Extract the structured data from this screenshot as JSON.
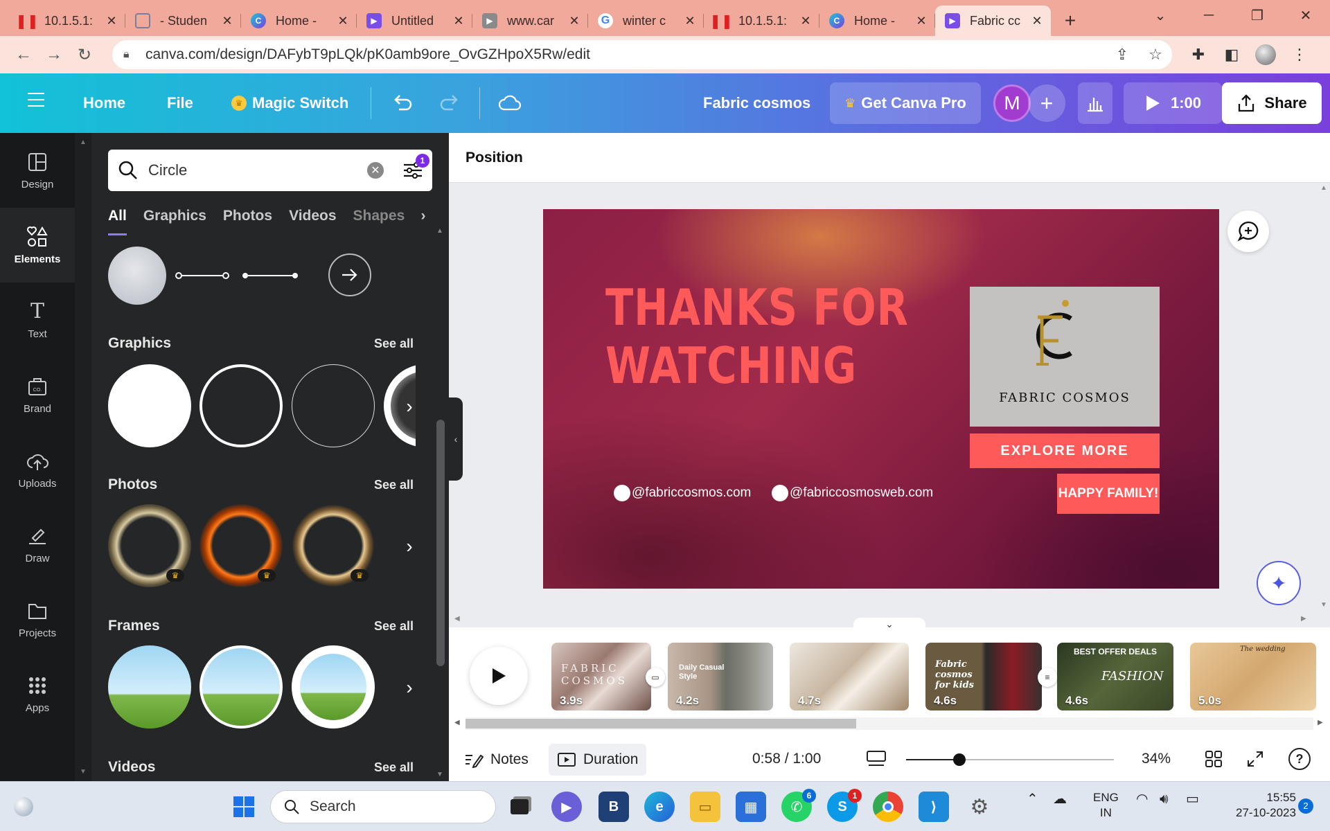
{
  "browser": {
    "tabs": [
      {
        "label": "10.1.5.1:",
        "icon": "pause-red-icon",
        "color": "#e02020"
      },
      {
        "label": "- Studen",
        "icon": "document-icon",
        "color": "#7a7f99"
      },
      {
        "label": "Home -",
        "icon": "canva-icon",
        "color": "#3a7be0"
      },
      {
        "label": "Untitled",
        "icon": "video-icon",
        "color": "#7a4de8"
      },
      {
        "label": "www.car",
        "icon": "play-icon",
        "color": "#8a8a8a"
      },
      {
        "label": "winter c",
        "icon": "google-icon",
        "color": "#ffffff"
      },
      {
        "label": "10.1.5.1:",
        "icon": "pause-red-icon",
        "color": "#e02020"
      },
      {
        "label": "Home -",
        "icon": "canva-icon",
        "color": "#3a7be0"
      },
      {
        "label": "Fabric cc",
        "icon": "video-icon",
        "color": "#7a4de8"
      }
    ],
    "url": "canva.com/design/DAFybT9pLQk/pK0amb9ore_OvGZHpoX5Rw/edit"
  },
  "canva": {
    "home": "Home",
    "file": "File",
    "magic_switch": "Magic Switch",
    "title": "Fabric cosmos",
    "get_pro": "Get Canva Pro",
    "avatar_initial": "M",
    "duration": "1:00",
    "share": "Share"
  },
  "rail": [
    {
      "label": "Design",
      "icon": "design-icon"
    },
    {
      "label": "Elements",
      "icon": "elements-icon"
    },
    {
      "label": "Text",
      "icon": "text-icon"
    },
    {
      "label": "Brand",
      "icon": "brand-icon"
    },
    {
      "label": "Uploads",
      "icon": "upload-icon"
    },
    {
      "label": "Draw",
      "icon": "draw-icon"
    },
    {
      "label": "Projects",
      "icon": "folder-icon"
    },
    {
      "label": "Apps",
      "icon": "apps-icon"
    }
  ],
  "panel": {
    "search_value": "Circle",
    "filter_badge": "1",
    "tabs": [
      "All",
      "Graphics",
      "Photos",
      "Videos",
      "Shapes"
    ],
    "sections": {
      "graphics": "Graphics",
      "photos": "Photos",
      "frames": "Frames",
      "videos": "Videos"
    },
    "see_all": "See all"
  },
  "editor": {
    "context": "Position",
    "slide": {
      "headline_1": "THANKS FOR",
      "headline_2": "WATCHING",
      "logo_text": "FABRIC COSMOS",
      "explore": "EXPLORE MORE",
      "happy": "HAPPY FAMILY!",
      "social_1": "@fabriccosmos.com",
      "social_2": "@fabriccosmosweb.com"
    }
  },
  "timeline": {
    "pages": [
      {
        "duration": "3.9s",
        "caption": "FABRIC COSMOS"
      },
      {
        "duration": "4.2s",
        "caption": "Daily Casual Style"
      },
      {
        "duration": "4.7s",
        "caption": ""
      },
      {
        "duration": "4.6s",
        "caption": "Fabric cosmos for kids"
      },
      {
        "duration": "4.6s",
        "caption": "BEST OFFER DEALS"
      },
      {
        "duration": "5.0s",
        "caption": "The wedding"
      }
    ],
    "thumb4_brand": "FASHION"
  },
  "bottom": {
    "notes": "Notes",
    "duration": "Duration",
    "time": "0:58 / 1:00",
    "zoom": "34%",
    "zoom_level": 0.34
  },
  "taskbar": {
    "search": "Search",
    "whatsapp_badge": "6",
    "skype_badge": "1",
    "lang_1": "ENG",
    "lang_2": "IN",
    "time": "15:55",
    "date": "27-10-2023",
    "notif": "2"
  }
}
